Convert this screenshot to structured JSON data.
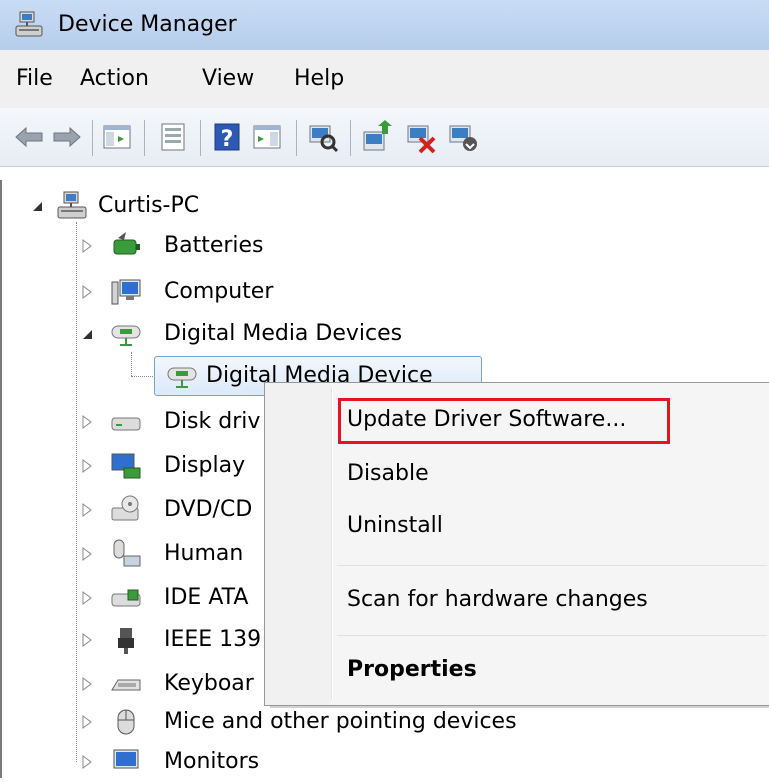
{
  "window": {
    "title": "Device Manager",
    "icon": "device-manager-icon"
  },
  "menu": {
    "items": [
      "File",
      "Action",
      "View",
      "Help"
    ]
  },
  "toolbar": {
    "buttons": [
      "back-arrow-icon",
      "forward-arrow-icon",
      "show-hide-console-tree-icon",
      "properties-icon",
      "help-icon",
      "action-pane-icon",
      "scan-hardware-icon",
      "update-driver-icon",
      "uninstall-device-icon",
      "disable-device-icon"
    ]
  },
  "tree": {
    "root": {
      "label": "Curtis-PC",
      "expanded": true
    },
    "nodes": [
      {
        "label": "Batteries",
        "icon": "battery-icon"
      },
      {
        "label": "Computer",
        "icon": "computer-icon"
      },
      {
        "label": "Digital Media Devices",
        "icon": "digital-media-icon",
        "expanded": true,
        "children": [
          {
            "label": "Digital Media Device",
            "icon": "digital-media-icon",
            "selected": true
          }
        ]
      },
      {
        "label": "Disk driv",
        "icon": "disk-drive-icon"
      },
      {
        "label": "Display",
        "icon": "display-adapter-icon"
      },
      {
        "label": "DVD/CD",
        "icon": "dvd-drive-icon"
      },
      {
        "label": "Human",
        "icon": "hid-icon"
      },
      {
        "label": "IDE ATA",
        "icon": "ide-controller-icon"
      },
      {
        "label": "IEEE 139",
        "icon": "firewire-icon"
      },
      {
        "label": "Keyboar",
        "icon": "keyboard-icon"
      },
      {
        "label": "Mice and other pointing devices",
        "icon": "mouse-icon"
      },
      {
        "label": "Monitors",
        "icon": "monitor-icon"
      }
    ]
  },
  "context_menu": {
    "items": [
      {
        "label": "Update Driver Software...",
        "highlighted": true
      },
      {
        "label": "Disable"
      },
      {
        "label": "Uninstall"
      },
      {
        "label": "Scan for hardware changes"
      },
      {
        "label": "Properties",
        "bold": true
      }
    ]
  },
  "colors": {
    "highlight_border": "#e4151c",
    "selection": "#dce9f8",
    "titlebar": "#c9dcf5"
  }
}
